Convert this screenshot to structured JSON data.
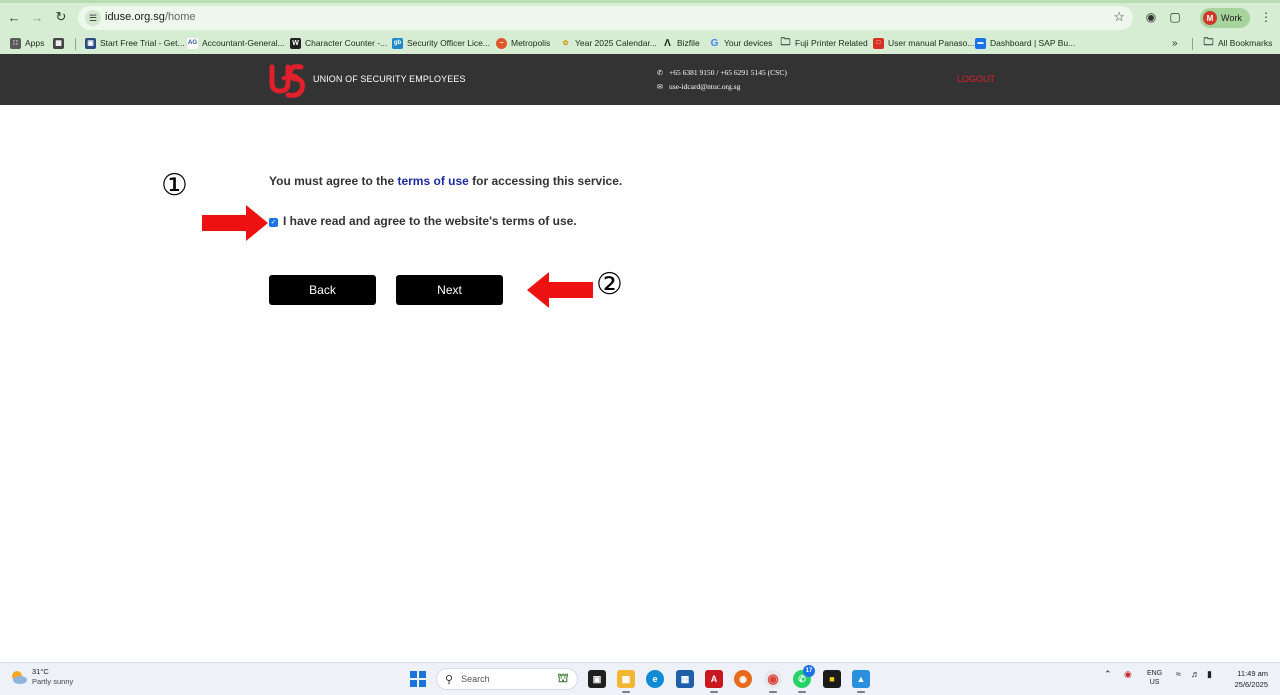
{
  "browser": {
    "url_host": "iduse.org.sg",
    "url_path": "/home",
    "profile_label": "Work",
    "profile_initial": "M",
    "bookmarks": [
      {
        "label": "Apps",
        "icon": "apps-grid-icon"
      },
      {
        "label": "Start Free Trial - Get...",
        "icon": "trial-icon"
      },
      {
        "label": "Accountant-General...",
        "icon": "ag-icon"
      },
      {
        "label": "Character Counter -...",
        "icon": "w-icon"
      },
      {
        "label": "Security Officer Lice...",
        "icon": "sg-icon"
      },
      {
        "label": "Metropolis",
        "icon": "metropolis-icon"
      },
      {
        "label": "Year 2025 Calendar...",
        "icon": "calendar-icon"
      },
      {
        "label": "Bizfile",
        "icon": "bizfile-icon"
      },
      {
        "label": "Your devices",
        "icon": "google-icon"
      },
      {
        "label": "Fuji Printer Related",
        "icon": "folder-icon"
      },
      {
        "label": "User manual Panaso...",
        "icon": "pdf-icon"
      },
      {
        "label": "Dashboard | SAP Bu...",
        "icon": "sap-icon"
      }
    ],
    "more_label": "»",
    "all_bookmarks_label": "All Bookmarks"
  },
  "site": {
    "logo_text": "USE",
    "org_name": "UNION OF SECURITY EMPLOYEES",
    "phone": "+65 6381 9150 / +65 6291 5145 (CSC)",
    "email": "use-idcard@ntuc.org.sg",
    "logout_label": "LOGOUT",
    "accent_color": "#e0212b"
  },
  "content": {
    "notice_prefix": "You must agree to the ",
    "terms_link": "terms of use",
    "notice_suffix": " for accessing this service.",
    "agree_label": "I have read and agree to the website's terms of use.",
    "agree_checked": true,
    "back_label": "Back",
    "next_label": "Next"
  },
  "annotations": {
    "step1": "①",
    "step2": "②",
    "arrow_color": "#ee1111"
  },
  "taskbar": {
    "temp": "31°C",
    "weather": "Partly sunny",
    "search_label": "Search",
    "whatsapp_badge": "17",
    "lang_top": "ENG",
    "lang_bottom": "US",
    "time": "11:49 am",
    "date": "25/6/2025"
  }
}
